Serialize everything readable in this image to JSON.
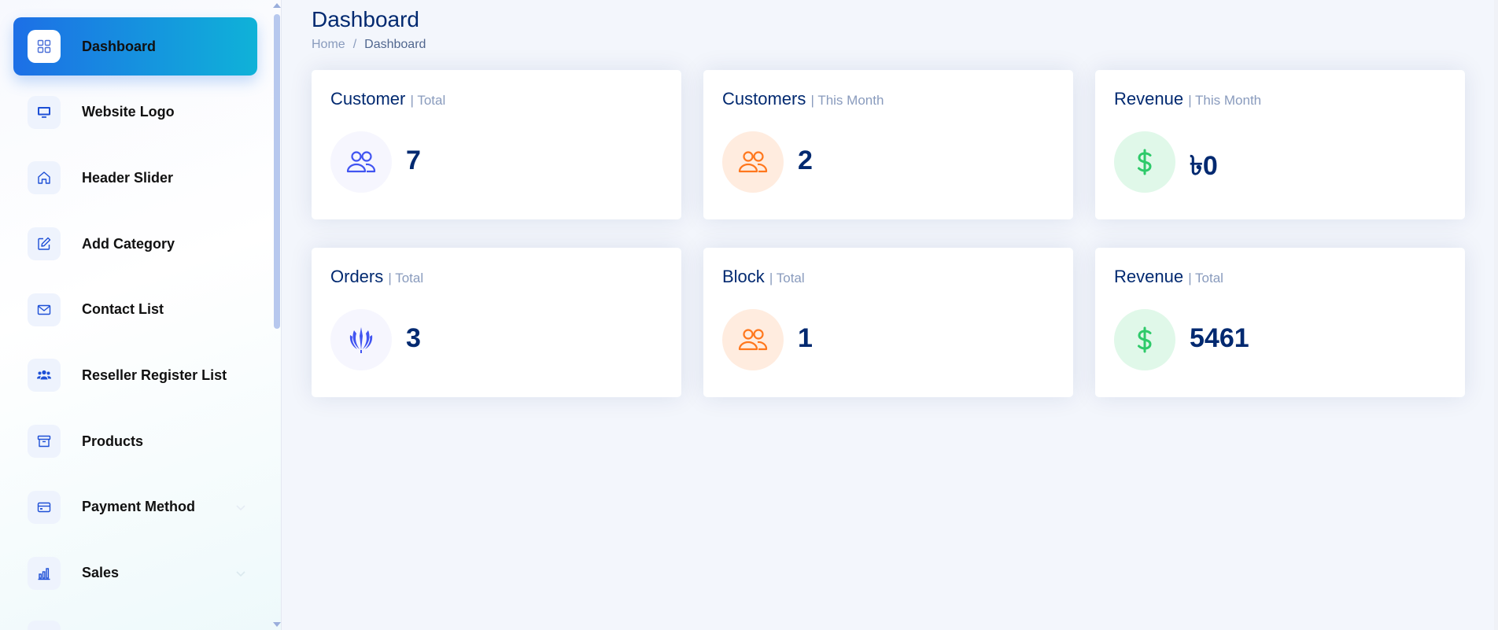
{
  "sidebar": {
    "items": [
      {
        "label": "Dashboard",
        "icon": "grid-icon",
        "active": true
      },
      {
        "label": "Website Logo",
        "icon": "monitor-icon"
      },
      {
        "label": "Header Slider",
        "icon": "home-icon"
      },
      {
        "label": "Add Category",
        "icon": "edit-icon"
      },
      {
        "label": "Contact List",
        "icon": "envelope-icon"
      },
      {
        "label": "Reseller Register List",
        "icon": "users-icon"
      },
      {
        "label": "Products",
        "icon": "archive-icon"
      },
      {
        "label": "Payment Method",
        "icon": "credit-card-icon",
        "has_submenu": true
      },
      {
        "label": "Sales",
        "icon": "bar-chart-icon",
        "has_submenu": true
      }
    ]
  },
  "header": {
    "title": "Dashboard",
    "breadcrumb": [
      "Home",
      "/",
      "Dashboard"
    ]
  },
  "cards": [
    {
      "title": "Customer",
      "subtitle": "| Total",
      "value": "7",
      "icon": "people-icon",
      "tone": "blue"
    },
    {
      "title": "Customers",
      "subtitle": "| This Month",
      "value": "2",
      "icon": "people-icon",
      "tone": "orange"
    },
    {
      "title": "Revenue",
      "subtitle": "| This Month",
      "value": "৳0",
      "icon": "dollar-icon",
      "tone": "green"
    },
    {
      "title": "Orders",
      "subtitle": "| Total",
      "value": "3",
      "icon": "order-emblem-icon",
      "tone": "blue"
    },
    {
      "title": "Block",
      "subtitle": "| Total",
      "value": "1",
      "icon": "people-icon",
      "tone": "orange"
    },
    {
      "title": "Revenue",
      "subtitle": "| Total",
      "value": "5461",
      "icon": "dollar-icon",
      "tone": "green"
    }
  ],
  "colors": {
    "primary": "#1d6fe6",
    "accent": "#0fb2d8",
    "heading": "#012970",
    "muted": "#899bbd",
    "blue_icon": "#4154f1",
    "orange_icon": "#ff771d",
    "green_icon": "#2eca6a"
  }
}
